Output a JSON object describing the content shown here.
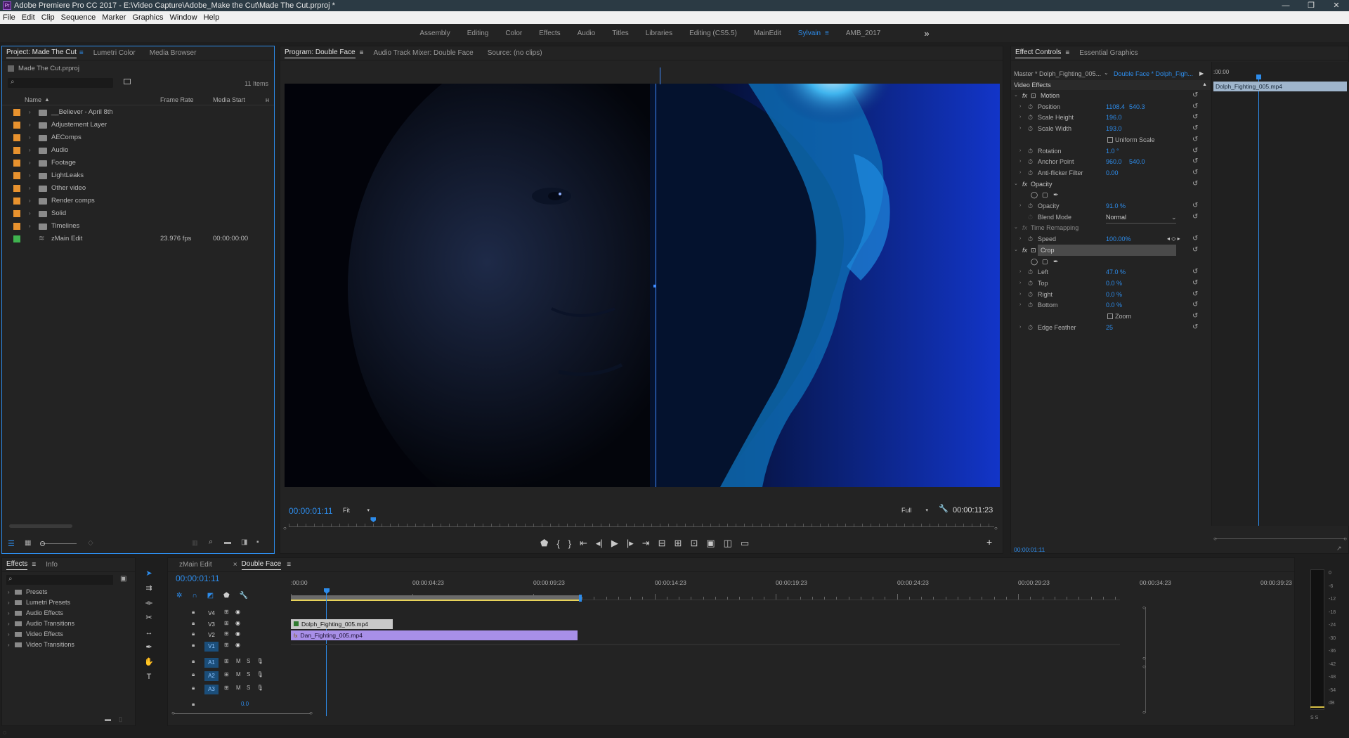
{
  "app": {
    "title": "Adobe Premiere Pro CC 2017 - E:\\Video Capture\\Adobe_Make the Cut\\Made The Cut.prproj *",
    "icon": "Pr"
  },
  "menu": [
    "File",
    "Edit",
    "Clip",
    "Sequence",
    "Marker",
    "Graphics",
    "Window",
    "Help"
  ],
  "workspaces": [
    "Assembly",
    "Editing",
    "Color",
    "Effects",
    "Audio",
    "Titles",
    "Libraries",
    "Editing (CS5.5)",
    "MainEdit",
    "Sylvain",
    "AMB_2017"
  ],
  "workspace_active": "Sylvain",
  "workspace_more": "»",
  "project": {
    "tabs": [
      "Project: Made The Cut",
      "Lumetri Color",
      "Media Browser"
    ],
    "file": "Made The Cut.prproj",
    "search_placeholder": "",
    "items_count": "11 Items",
    "columns": [
      "Name",
      "Frame Rate",
      "Media Start"
    ],
    "rows": [
      {
        "name": "__Believer - April 8th",
        "color": "#e8922e",
        "type": "folder",
        "rate": "",
        "start": ""
      },
      {
        "name": "Adjustement Layer",
        "color": "#e8922e",
        "type": "folder",
        "rate": "",
        "start": ""
      },
      {
        "name": "AEComps",
        "color": "#e8922e",
        "type": "folder",
        "rate": "",
        "start": ""
      },
      {
        "name": "Audio",
        "color": "#e8922e",
        "type": "folder",
        "rate": "",
        "start": ""
      },
      {
        "name": "Footage",
        "color": "#e8922e",
        "type": "folder",
        "rate": "",
        "start": ""
      },
      {
        "name": "LightLeaks",
        "color": "#e8922e",
        "type": "folder",
        "rate": "",
        "start": ""
      },
      {
        "name": "Other video",
        "color": "#e8922e",
        "type": "folder",
        "rate": "",
        "start": ""
      },
      {
        "name": "Render comps",
        "color": "#e8922e",
        "type": "folder",
        "rate": "",
        "start": ""
      },
      {
        "name": "Solid",
        "color": "#e8922e",
        "type": "folder",
        "rate": "",
        "start": ""
      },
      {
        "name": "Timelines",
        "color": "#e8922e",
        "type": "folder",
        "rate": "",
        "start": ""
      },
      {
        "name": "zMain Edit",
        "color": "#3fb34f",
        "type": "sequence",
        "rate": "23.976 fps",
        "start": "00:00:00:00"
      }
    ]
  },
  "program": {
    "tabs": [
      "Program: Double Face",
      "Audio Track Mixer: Double Face",
      "Source: (no clips)"
    ],
    "timecode": "00:00:01:11",
    "fit": "Fit",
    "quality": "Full",
    "duration": "00:00:11:23",
    "playhead": 0.12
  },
  "effect_controls": {
    "tabs": [
      "Effect Controls",
      "Essential Graphics"
    ],
    "master": "Master * Dolph_Fighting_005...",
    "sequence_clip": "Double Face * Dolph_Figh...",
    "ruler_time": ":00:00",
    "clip_bar": "Dolph_Fighting_005.mp4",
    "section": "Video Effects",
    "timecode": "00:00:01:11",
    "rows": [
      {
        "kind": "fx",
        "label": "Motion"
      },
      {
        "kind": "prop",
        "label": "Position",
        "v1": "1108.4",
        "v2": "540.3"
      },
      {
        "kind": "prop",
        "label": "Scale Height",
        "v1": "196.0"
      },
      {
        "kind": "prop",
        "label": "Scale Width",
        "v1": "193.0"
      },
      {
        "kind": "check",
        "label": "Uniform Scale"
      },
      {
        "kind": "prop",
        "label": "Rotation",
        "v1": "1.0 °"
      },
      {
        "kind": "prop",
        "label": "Anchor Point",
        "v1": "960.0",
        "v2": "540.0"
      },
      {
        "kind": "prop",
        "label": "Anti-flicker Filter",
        "v1": "0.00"
      },
      {
        "kind": "fx",
        "label": "Opacity"
      },
      {
        "kind": "masks"
      },
      {
        "kind": "prop",
        "label": "Opacity",
        "v1": "91.0 %"
      },
      {
        "kind": "select",
        "label": "Blend Mode",
        "v1": "Normal"
      },
      {
        "kind": "fxoff",
        "label": "Time Remapping"
      },
      {
        "kind": "prop",
        "label": "Speed",
        "v1": "100.00%"
      },
      {
        "kind": "fx",
        "label": "Crop",
        "highlight": true
      },
      {
        "kind": "masks"
      },
      {
        "kind": "prop",
        "label": "Left",
        "v1": "47.0 %"
      },
      {
        "kind": "prop",
        "label": "Top",
        "v1": "0.0 %"
      },
      {
        "kind": "prop",
        "label": "Right",
        "v1": "0.0 %"
      },
      {
        "kind": "prop",
        "label": "Bottom",
        "v1": "0.0 %"
      },
      {
        "kind": "check",
        "label": "Zoom"
      },
      {
        "kind": "prop",
        "label": "Edge Feather",
        "v1": "25"
      }
    ]
  },
  "effects": {
    "tabs": [
      "Effects",
      "Info"
    ],
    "items": [
      "Presets",
      "Lumetri Presets",
      "Audio Effects",
      "Audio Transitions",
      "Video Effects",
      "Video Transitions"
    ]
  },
  "timeline": {
    "tabs": [
      "zMain Edit",
      "Double Face"
    ],
    "close": "×",
    "timecode": "00:00:01:11",
    "ruler": [
      ":00:00",
      "00:00:04:23",
      "00:00:09:23",
      "00:00:14:23",
      "00:00:19:23",
      "00:00:24:23",
      "00:00:29:23",
      "00:00:34:23",
      "00:00:39:23"
    ],
    "video_tracks": [
      "V4",
      "V3",
      "V2",
      "V1"
    ],
    "audio_tracks": [
      "A1",
      "A2",
      "A3"
    ],
    "master_level": "0.0",
    "clips": [
      {
        "name": "Dolph_Fighting_005.mp4",
        "track": "V3"
      },
      {
        "name": "Dan_Fighting_005.mp4",
        "track": "V2"
      }
    ]
  },
  "meters": {
    "labels": [
      "0",
      "-6",
      "-12",
      "-18",
      "-24",
      "-30",
      "-36",
      "-42",
      "-48",
      "-54",
      "dB"
    ],
    "ss": "S S"
  },
  "colors": {
    "accent": "#2d8ceb",
    "clip_v3": "#c9c9c9",
    "clip_v2": "#a88fe8",
    "label_orange": "#e8922e",
    "label_green": "#3fb34f"
  }
}
